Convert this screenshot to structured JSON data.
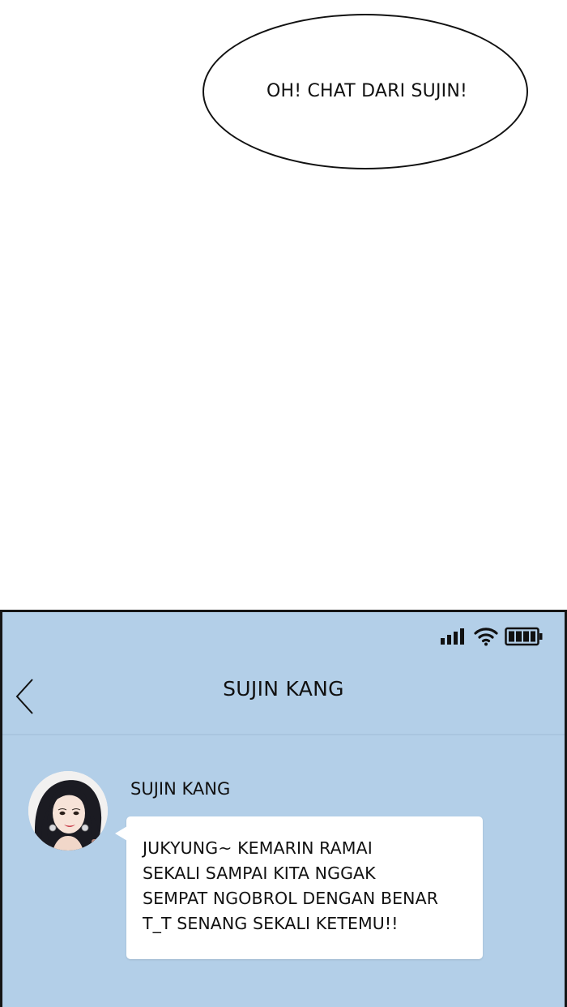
{
  "speech_bubble": {
    "text": "OH! CHAT DARI SUJIN!"
  },
  "status_bar": {
    "icons": [
      "signal-icon",
      "wifi-icon",
      "battery-icon"
    ]
  },
  "header": {
    "back_icon": "chevron-left-icon",
    "title": "SUJIN KANG"
  },
  "message": {
    "sender": "SUJIN KANG",
    "lines": [
      "JUKYUNG~ KEMARIN RAMAI",
      "SEKALI SAMPAI KITA NGGAK",
      "SEMPAT NGOBROL DENGAN BENAR",
      "T_T SENANG SEKALI KETEMU!!"
    ]
  },
  "colors": {
    "chat_background": "#b3cfe8",
    "bubble": "#ffffff",
    "text": "#111111"
  }
}
